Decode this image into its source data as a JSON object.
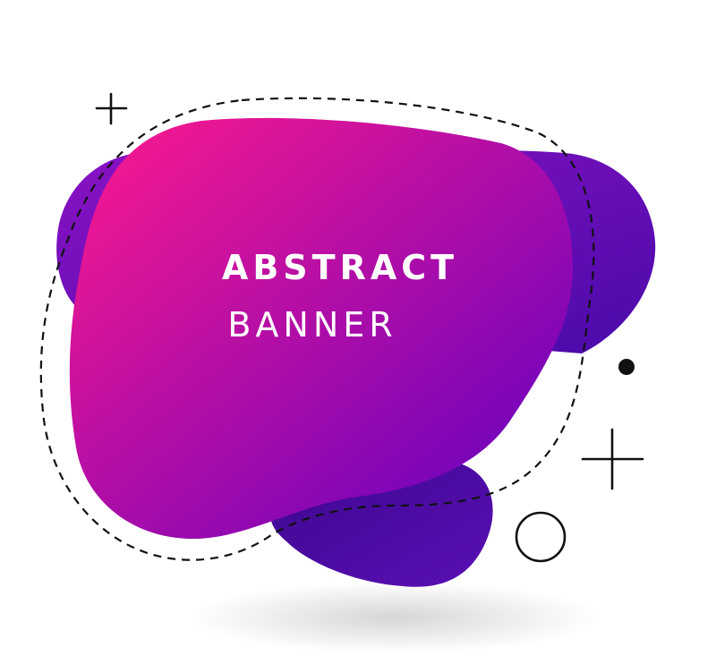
{
  "banner": {
    "title": "ABSTRACT",
    "subtitle": "BANNER"
  },
  "colors": {
    "background": "#ffffff",
    "blob_front_start": "#ff1a8c",
    "blob_front_end": "#6a00c4",
    "blob_back_start": "#7a10c8",
    "blob_back_end": "#4a0aa8",
    "blob_bottom": "#4b0b9a",
    "stroke": "#111111"
  },
  "decorations": {
    "shapes": [
      "plus",
      "dot",
      "plus",
      "circle"
    ]
  }
}
